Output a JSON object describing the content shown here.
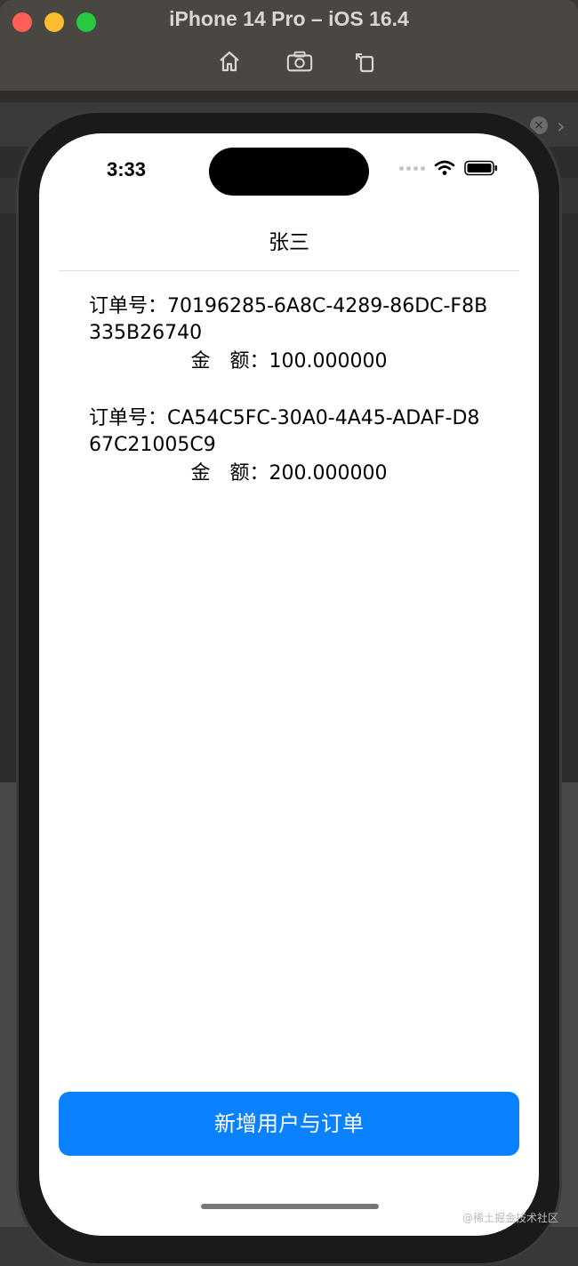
{
  "window": {
    "title": "iPhone 14 Pro – iOS 16.4",
    "toolbar": {
      "home_icon": "home-icon",
      "screenshot_icon": "camera-icon",
      "rotate_icon": "rotate-icon"
    }
  },
  "status_bar": {
    "time": "3:33"
  },
  "nav": {
    "title": "张三"
  },
  "orders": [
    {
      "id_label": "订单号：",
      "id": "70196285-6A8C-4289-86DC-F8B335B26740",
      "amount_label": "金　额：",
      "amount": "100.000000"
    },
    {
      "id_label": "订单号：",
      "id": "CA54C5FC-30A0-4A45-ADAF-D867C21005C9",
      "amount_label": "金　额：",
      "amount": "200.000000"
    }
  ],
  "add_button": {
    "label": "新增用户与订单"
  },
  "watermark": "@稀土掘金技术社区",
  "colors": {
    "accent": "#0a82ff",
    "background": "#ffffff",
    "window_chrome": "#4a4642"
  }
}
